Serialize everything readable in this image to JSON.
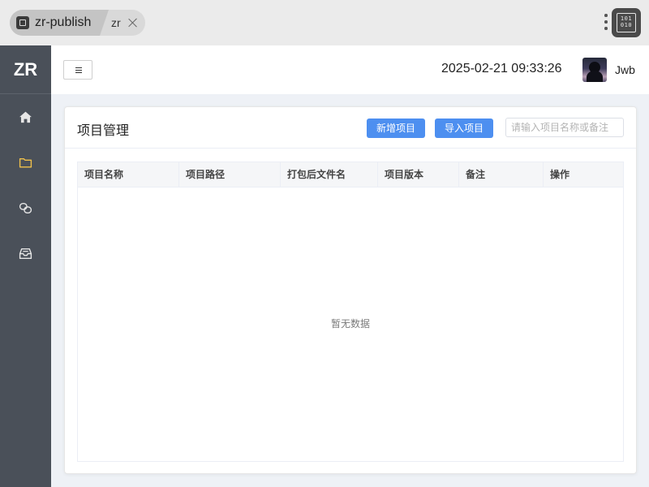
{
  "browser": {
    "tab_primary": "zr-publish",
    "tab_secondary": "zr",
    "binary_icon_text": [
      "101",
      "010"
    ]
  },
  "sidebar": {
    "logo": "ZR",
    "items": [
      {
        "icon": "home-icon",
        "active": false
      },
      {
        "icon": "folder-icon",
        "active": true
      },
      {
        "icon": "link-icon",
        "active": false
      },
      {
        "icon": "inbox-icon",
        "active": false
      }
    ],
    "colors": {
      "background": "#4a5059",
      "icon": "#e6e6e6",
      "active_icon": "#f0c14b"
    }
  },
  "header": {
    "datetime": "2025-02-21 09:33:26",
    "username": "Jwb"
  },
  "card": {
    "title": "项目管理",
    "new_button": "新增项目",
    "import_button": "导入项目",
    "search_placeholder": "请输入项目名称或备注",
    "search_value": "",
    "columns": [
      "项目名称",
      "项目路径",
      "打包后文件名",
      "项目版本",
      "备注",
      "操作"
    ],
    "rows": [],
    "empty_text": "暂无数据",
    "accent_color": "#4d8ff0"
  }
}
